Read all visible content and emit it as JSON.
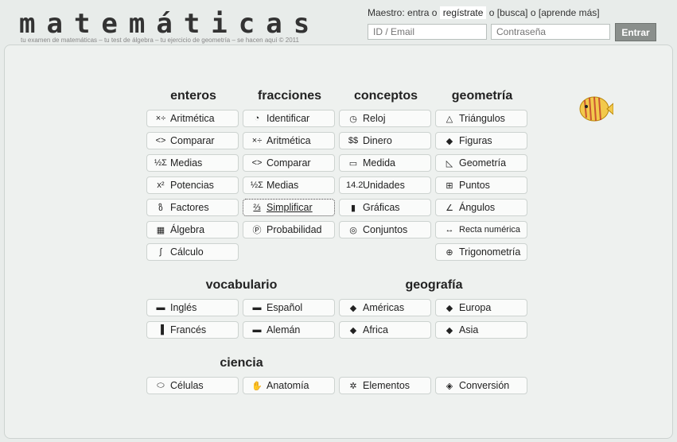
{
  "header": {
    "logo": "matemáticas",
    "tagline": "tu examen de matemáticas – tu test de álgebra – tu ejercicio de geometría – se hacen aquí © 2011",
    "nav_prefix": "Maestro: entra o",
    "register": "regístrate",
    "or1": "o",
    "search": "[busca]",
    "or2": "o",
    "learn": "[aprende más]",
    "id_placeholder": "ID / Email",
    "password_placeholder": "Contraseña",
    "submit": "Entrar"
  },
  "sections": {
    "enteros": "enteros",
    "fracciones": "fracciones",
    "conceptos": "conceptos",
    "geometria": "geometría",
    "vocabulario": "vocabulario",
    "geografia": "geografía",
    "ciencia": "ciencia"
  },
  "enteros": [
    {
      "icon": "×÷",
      "label": "Aritmética"
    },
    {
      "icon": "<>",
      "label": "Comparar"
    },
    {
      "icon": "½Σ",
      "label": "Medias"
    },
    {
      "icon": "x²",
      "label": "Potencias"
    },
    {
      "icon": "ზ",
      "label": "Factores"
    },
    {
      "icon": "▦",
      "label": "Álgebra"
    },
    {
      "icon": "∫",
      "label": "Cálculo"
    }
  ],
  "fracciones": [
    {
      "icon": "◔",
      "label": "Identificar"
    },
    {
      "icon": "×÷",
      "label": "Aritmética"
    },
    {
      "icon": "<>",
      "label": "Comparar"
    },
    {
      "icon": "½Σ",
      "label": "Medias"
    },
    {
      "icon": "⅔",
      "label": "Simplificar"
    },
    {
      "icon": "Ⓟ",
      "label": "Probabilidad"
    }
  ],
  "conceptos": [
    {
      "icon": "◷",
      "label": "Reloj"
    },
    {
      "icon": "$$",
      "label": "Dinero"
    },
    {
      "icon": "▭",
      "label": "Medida"
    },
    {
      "icon": "14.2",
      "label": "Unidades"
    },
    {
      "icon": "▮",
      "label": "Gráficas"
    },
    {
      "icon": "◎",
      "label": "Conjuntos"
    }
  ],
  "geometria": [
    {
      "icon": "△",
      "label": "Triángulos"
    },
    {
      "icon": "◆",
      "label": "Figuras"
    },
    {
      "icon": "◺",
      "label": "Geometría"
    },
    {
      "icon": "⊞",
      "label": "Puntos"
    },
    {
      "icon": "∠",
      "label": "Ángulos"
    },
    {
      "icon": "↔",
      "label": "Recta numérica"
    },
    {
      "icon": "⊕",
      "label": "Trigonometría"
    }
  ],
  "vocabulario": [
    {
      "icon": "▬",
      "label": "Inglés"
    },
    {
      "icon": "▬",
      "label": "Español"
    },
    {
      "icon": "▐",
      "label": "Francés"
    },
    {
      "icon": "▬",
      "label": "Alemán"
    }
  ],
  "geografia": [
    {
      "icon": "◆",
      "label": "Américas"
    },
    {
      "icon": "◆",
      "label": "Europa"
    },
    {
      "icon": "◆",
      "label": "Africa"
    },
    {
      "icon": "◆",
      "label": "Asia"
    }
  ],
  "ciencia": [
    {
      "icon": "⬭",
      "label": "Células"
    },
    {
      "icon": "✋",
      "label": "Anatomía"
    },
    {
      "icon": "✲",
      "label": "Elementos"
    },
    {
      "icon": "◈",
      "label": "Conversión"
    }
  ]
}
